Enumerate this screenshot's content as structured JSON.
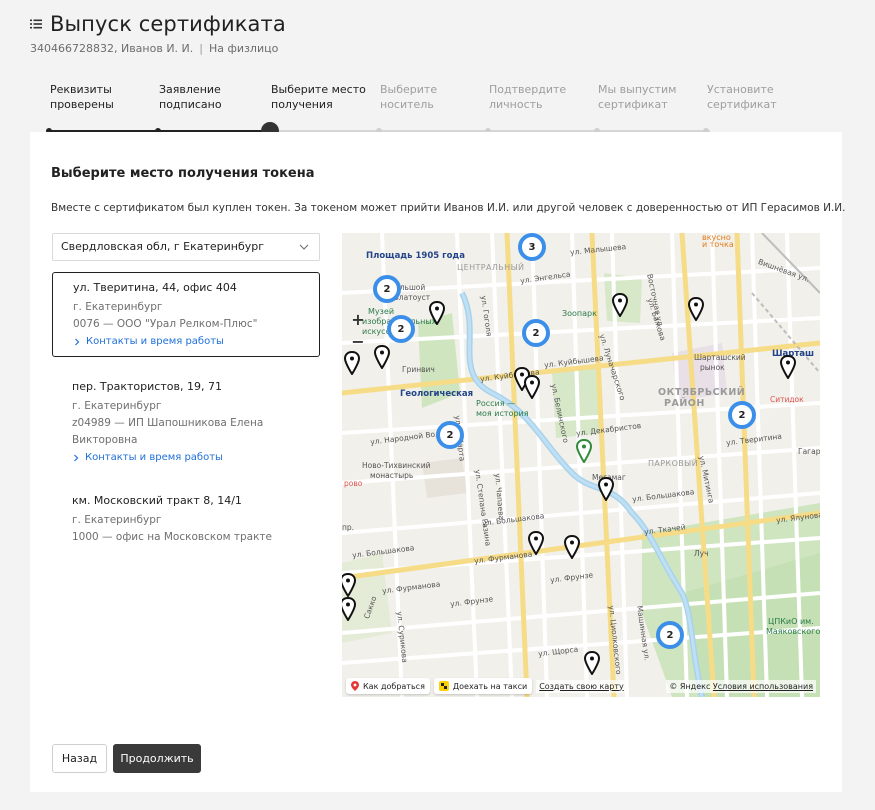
{
  "header": {
    "title": "Выпуск сертификата",
    "subtitle_id_name": "340466728832, Иванов И. И.",
    "subtitle_type": "На физлицо"
  },
  "steps": [
    {
      "line1": "Реквизиты",
      "line2": "проверены",
      "state": "done"
    },
    {
      "line1": "Заявление",
      "line2": "подписано",
      "state": "done"
    },
    {
      "line1": "Выберите место",
      "line2": "получения",
      "state": "active"
    },
    {
      "line1": "Выберите",
      "line2": "носитель",
      "state": "todo"
    },
    {
      "line1": "Подтвердите",
      "line2": "личность",
      "state": "todo"
    },
    {
      "line1": "Мы выпустим",
      "line2": "сертификат",
      "state": "todo"
    },
    {
      "line1": "Установите",
      "line2": "сертификат",
      "state": "todo"
    }
  ],
  "main": {
    "section_title": "Выберите место получения токена",
    "description": "Вместе с сертификатом был куплен токен. За токеном может прийти Иванов И.И. или другой человек с доверенностью от ИП Герасимов И.И.",
    "region": "Свердловская обл, г Екатеринбург"
  },
  "offices": [
    {
      "name": "ул. Тверитина, 44, офис 404",
      "city": "г. Екатеринбург",
      "line": "0076 — ООО \"Урал Релком-Плюс\"",
      "contacts": "Контакты и время работы"
    },
    {
      "name": "пер. Трактористов, 19, 71",
      "city": "г. Екатеринбург",
      "line": "z04989 — ИП Шапошникова Елена",
      "line2": "Викторовна",
      "contacts": "Контакты и время работы"
    },
    {
      "name": "км. Московский тракт 8, 14/1",
      "city": "г. Екатеринбург",
      "line": "1000 — офис на Московском тракте"
    }
  ],
  "map": {
    "clusters": [
      "3",
      "2",
      "2",
      "2",
      "2",
      "2",
      "2"
    ],
    "labels": {
      "square1905": "Площадь 1905 года",
      "central": "ЦЕНТРАЛЬНЫЙ",
      "bolshoi": "Большой",
      "zlatoust": "Златоуст",
      "museum1": "Музей",
      "museum2": "изобразительных",
      "museum3": "искусств",
      "grinvich": "Гринвич",
      "geological": "Геологическая",
      "russia1": "Россия —",
      "russia2": "моя история",
      "zoo": "Зоопарк",
      "shartash_market1": "Шарташский",
      "shartash_market2": "рынок",
      "shartash": "Шарташ",
      "oktyabrsky1": "ОКТЯБРЬСКИЙ",
      "oktyabrsky2": "РАЙОН",
      "sitidok": "Ситидок",
      "park": "ПАРКОВЫЙ",
      "monastery1": "Ново-Тихвинский",
      "monastery2": "монастырь",
      "megamag": "Мегамаг",
      "luch": "Луч",
      "gagarin": "Гагарин",
      "tskp1": "ЦПКиО им.",
      "tskp2": "Маяковского",
      "vkusno1": "вкусно",
      "vkusno2": "и точка",
      "vostochnaya": "Восточная ул.",
      "vishnevaya": "Вишнёвая ул.",
      "malysheva": "ул. Малышева",
      "engelsa": "ул. Энгельса",
      "kuibysheva1": "ул. Куйбышева",
      "kuibysheva2": "ул. Куйбышева",
      "dekabristov": "ул. Декабристов",
      "narodnoy_voli": "ул. Народной Воли",
      "tveritina": "ул. Тверитина",
      "tkachey": "ул. Ткачей",
      "yalamova": "ул. Ялунова",
      "furmanova1": "ул. Фурманова",
      "furmanova2": "ул. Фурманова",
      "bolshakova1": "ул. Большакова",
      "bolshakova2": "ул. Большакова",
      "bolshakova3": "ул. Большакова",
      "frunze1": "ул. Фрунзе",
      "frunze2": "ул. Фрунзе",
      "shorsa": "ул. Щорса",
      "gogolya": "ул. Гоголя",
      "belinskogo": "ул. Белинского",
      "lunacharskogo": "ул. Луначарского",
      "bazhova": "ул. Бажова",
      "chapaeva": "ул. Чапаева",
      "stepana": "ул. Степана Разина",
      "martha": "ул. 8 Марта",
      "mashinnaya": "Машинная ул.",
      "tsiolkovskogo": "ул. Циолковского",
      "mitinga": "ул. Митинга",
      "sakko": "Сакко",
      "surikova": "ул. Сурикова",
      "proezd": "пр.",
      "provo": "рово"
    },
    "route_btn": "Как добраться",
    "taxi_btn": "Доехать на такси",
    "create_map": "Создать свою карту",
    "copyright": "© Яндекс",
    "terms": "Условия использования"
  },
  "buttons": {
    "back": "Назад",
    "next": "Продолжить"
  },
  "colors": {
    "accent_dark": "#3a3a3a",
    "link": "#1e6fd9",
    "cluster": "#3b8fe8"
  }
}
